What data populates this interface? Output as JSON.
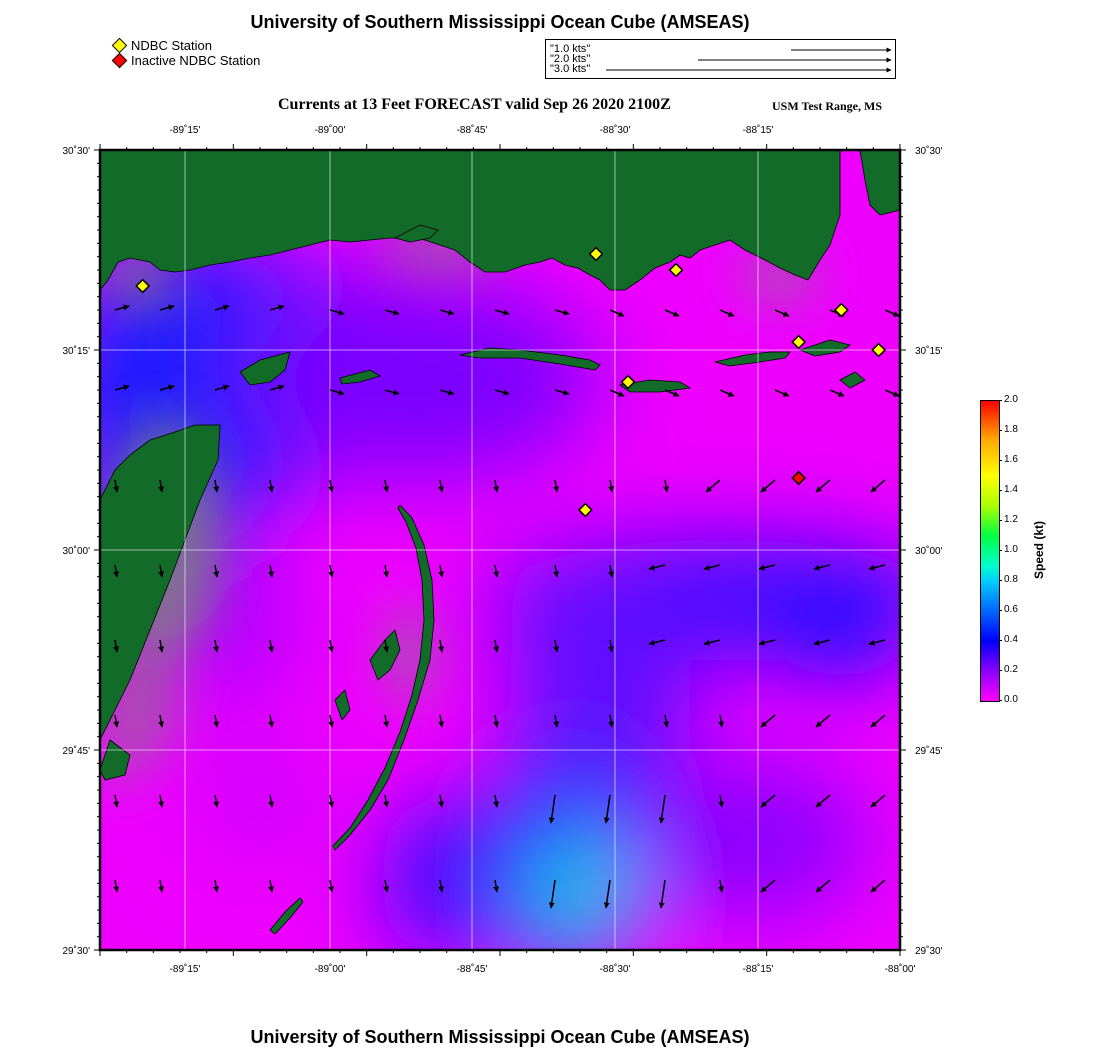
{
  "title_top": "University of Southern Mississippi Ocean Cube (AMSEAS)",
  "title_bottom": "University of Southern Mississippi Ocean Cube (AMSEAS)",
  "subtitle": "Currents at 13 Feet FORECAST valid Sep 26 2020 2100Z",
  "region": "USM Test Range, MS",
  "legend": {
    "active": {
      "label": "NDBC Station",
      "color": "#ffff00"
    },
    "inactive": {
      "label": "Inactive NDBC Station",
      "color": "#ff0000"
    }
  },
  "vector_key": {
    "labels": [
      "1.0 kts",
      "2.0 kts",
      "3.0 kts"
    ]
  },
  "axes": {
    "x_ticks": [
      "-89˚15'",
      "-89˚00'",
      "-88˚45'",
      "-88˚30'",
      "-88˚15'",
      "-88˚00'"
    ],
    "y_ticks": [
      "30˚30'",
      "30˚15'",
      "30˚00'",
      "29˚45'",
      "29˚30'"
    ],
    "lon_range": [
      -89.5,
      -88.0
    ],
    "lat_range": [
      29.5,
      30.5
    ]
  },
  "colorbar": {
    "label": "Speed (kt)",
    "ticks": [
      "0.0",
      "0.2",
      "0.4",
      "0.6",
      "0.8",
      "1.0",
      "1.2",
      "1.4",
      "1.6",
      "1.8",
      "2.0"
    ],
    "range": [
      0,
      2.0
    ]
  },
  "colors": {
    "land": "#136b2a",
    "marsh": "#7f7f7f",
    "low_speed": "#ff00ff",
    "mid_speed": "#0000ff",
    "high_speed": "#00ffdd"
  },
  "stations": [
    {
      "lon": -89.42,
      "lat": 30.33,
      "status": "active"
    },
    {
      "lon": -88.57,
      "lat": 30.37,
      "status": "active"
    },
    {
      "lon": -88.42,
      "lat": 30.35,
      "status": "active"
    },
    {
      "lon": -88.11,
      "lat": 30.3,
      "status": "active"
    },
    {
      "lon": -88.19,
      "lat": 30.26,
      "status": "active"
    },
    {
      "lon": -88.04,
      "lat": 30.25,
      "status": "active"
    },
    {
      "lon": -88.51,
      "lat": 30.21,
      "status": "active"
    },
    {
      "lon": -88.59,
      "lat": 30.05,
      "status": "active"
    },
    {
      "lon": -88.19,
      "lat": 30.09,
      "status": "inactive"
    }
  ]
}
